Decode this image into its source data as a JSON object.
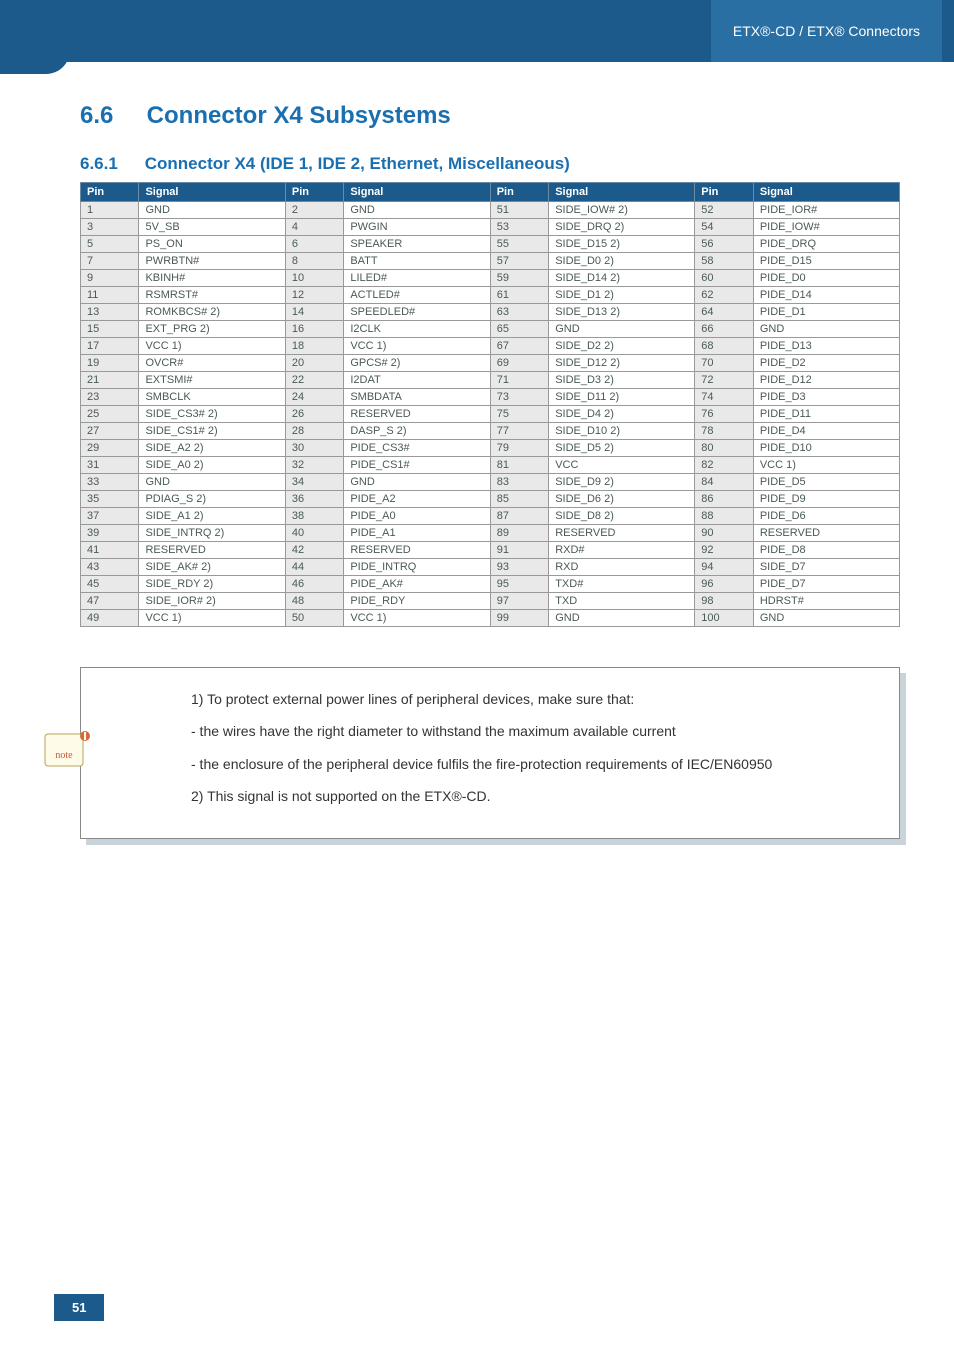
{
  "header": {
    "breadcrumb": "ETX®-CD / ETX® Connectors"
  },
  "section": {
    "number": "6.6",
    "title": "Connector X4 Subsystems",
    "sub_number": "6.6.1",
    "sub_title": "Connector X4 (IDE 1, IDE 2, Ethernet, Miscellaneous)"
  },
  "table_headers": [
    "Pin",
    "Signal",
    "Pin",
    "Signal",
    "Pin",
    "Signal",
    "Pin",
    "Signal"
  ],
  "rows": [
    [
      "1",
      "GND",
      "2",
      "GND",
      "51",
      "SIDE_IOW# 2)",
      "52",
      "PIDE_IOR#"
    ],
    [
      "3",
      "5V_SB",
      "4",
      "PWGIN",
      "53",
      "SIDE_DRQ 2)",
      "54",
      "PIDE_IOW#"
    ],
    [
      "5",
      "PS_ON",
      "6",
      "SPEAKER",
      "55",
      "SIDE_D15 2)",
      "56",
      "PIDE_DRQ"
    ],
    [
      "7",
      "PWRBTN#",
      "8",
      "BATT",
      "57",
      "SIDE_D0 2)",
      "58",
      "PIDE_D15"
    ],
    [
      "9",
      "KBINH#",
      "10",
      "LILED#",
      "59",
      "SIDE_D14 2)",
      "60",
      "PIDE_D0"
    ],
    [
      "11",
      "RSMRST#",
      "12",
      "ACTLED#",
      "61",
      "SIDE_D1 2)",
      "62",
      "PIDE_D14"
    ],
    [
      "13",
      "ROMKBCS# 2)",
      "14",
      "SPEEDLED#",
      "63",
      "SIDE_D13 2)",
      "64",
      "PIDE_D1"
    ],
    [
      "15",
      "EXT_PRG 2)",
      "16",
      "I2CLK",
      "65",
      "GND",
      "66",
      "GND"
    ],
    [
      "17",
      "VCC 1)",
      "18",
      "VCC 1)",
      "67",
      "SIDE_D2 2)",
      "68",
      "PIDE_D13"
    ],
    [
      "19",
      "OVCR#",
      "20",
      "GPCS# 2)",
      "69",
      "SIDE_D12 2)",
      "70",
      "PIDE_D2"
    ],
    [
      "21",
      "EXTSMI#",
      "22",
      "I2DAT",
      "71",
      "SIDE_D3 2)",
      "72",
      "PIDE_D12"
    ],
    [
      "23",
      "SMBCLK",
      "24",
      "SMBDATA",
      "73",
      "SIDE_D11 2)",
      "74",
      "PIDE_D3"
    ],
    [
      "25",
      "SIDE_CS3# 2)",
      "26",
      "RESERVED",
      "75",
      "SIDE_D4 2)",
      "76",
      "PIDE_D11"
    ],
    [
      "27",
      "SIDE_CS1# 2)",
      "28",
      "DASP_S 2)",
      "77",
      "SIDE_D10 2)",
      "78",
      "PIDE_D4"
    ],
    [
      "29",
      "SIDE_A2 2)",
      "30",
      "PIDE_CS3#",
      "79",
      "SIDE_D5 2)",
      "80",
      "PIDE_D10"
    ],
    [
      "31",
      "SIDE_A0 2)",
      "32",
      "PIDE_CS1#",
      "81",
      "VCC",
      "82",
      "VCC 1)"
    ],
    [
      "33",
      "GND",
      "34",
      "GND",
      "83",
      "SIDE_D9 2)",
      "84",
      "PIDE_D5"
    ],
    [
      "35",
      "PDIAG_S 2)",
      "36",
      "PIDE_A2",
      "85",
      "SIDE_D6 2)",
      "86",
      "PIDE_D9"
    ],
    [
      "37",
      "SIDE_A1 2)",
      "38",
      "PIDE_A0",
      "87",
      "SIDE_D8 2)",
      "88",
      "PIDE_D6"
    ],
    [
      "39",
      "SIDE_INTRQ 2)",
      "40",
      "PIDE_A1",
      "89",
      "RESERVED",
      "90",
      "RESERVED"
    ],
    [
      "41",
      "RESERVED",
      "42",
      "RESERVED",
      "91",
      "RXD#",
      "92",
      "PIDE_D8"
    ],
    [
      "43",
      "SIDE_AK# 2)",
      "44",
      "PIDE_INTRQ",
      "93",
      "RXD",
      "94",
      "SIDE_D7"
    ],
    [
      "45",
      "SIDE_RDY 2)",
      "46",
      "PIDE_AK#",
      "95",
      "TXD#",
      "96",
      "PIDE_D7"
    ],
    [
      "47",
      "SIDE_IOR# 2)",
      "48",
      "PIDE_RDY",
      "97",
      "TXD",
      "98",
      "HDRST#"
    ],
    [
      "49",
      "VCC 1)",
      "50",
      "VCC 1)",
      "99",
      "GND",
      "100",
      "GND"
    ]
  ],
  "notes": [
    "1) To protect external power lines of peripheral devices, make sure that:",
    "- the wires have the right diameter to withstand the maximum available current",
    "- the enclosure of the peripheral device fulfils the fire-protection requirements of IEC/EN60950",
    "2) This signal is not supported on the ETX®-CD."
  ],
  "page_number": "51",
  "icon_label": "note"
}
